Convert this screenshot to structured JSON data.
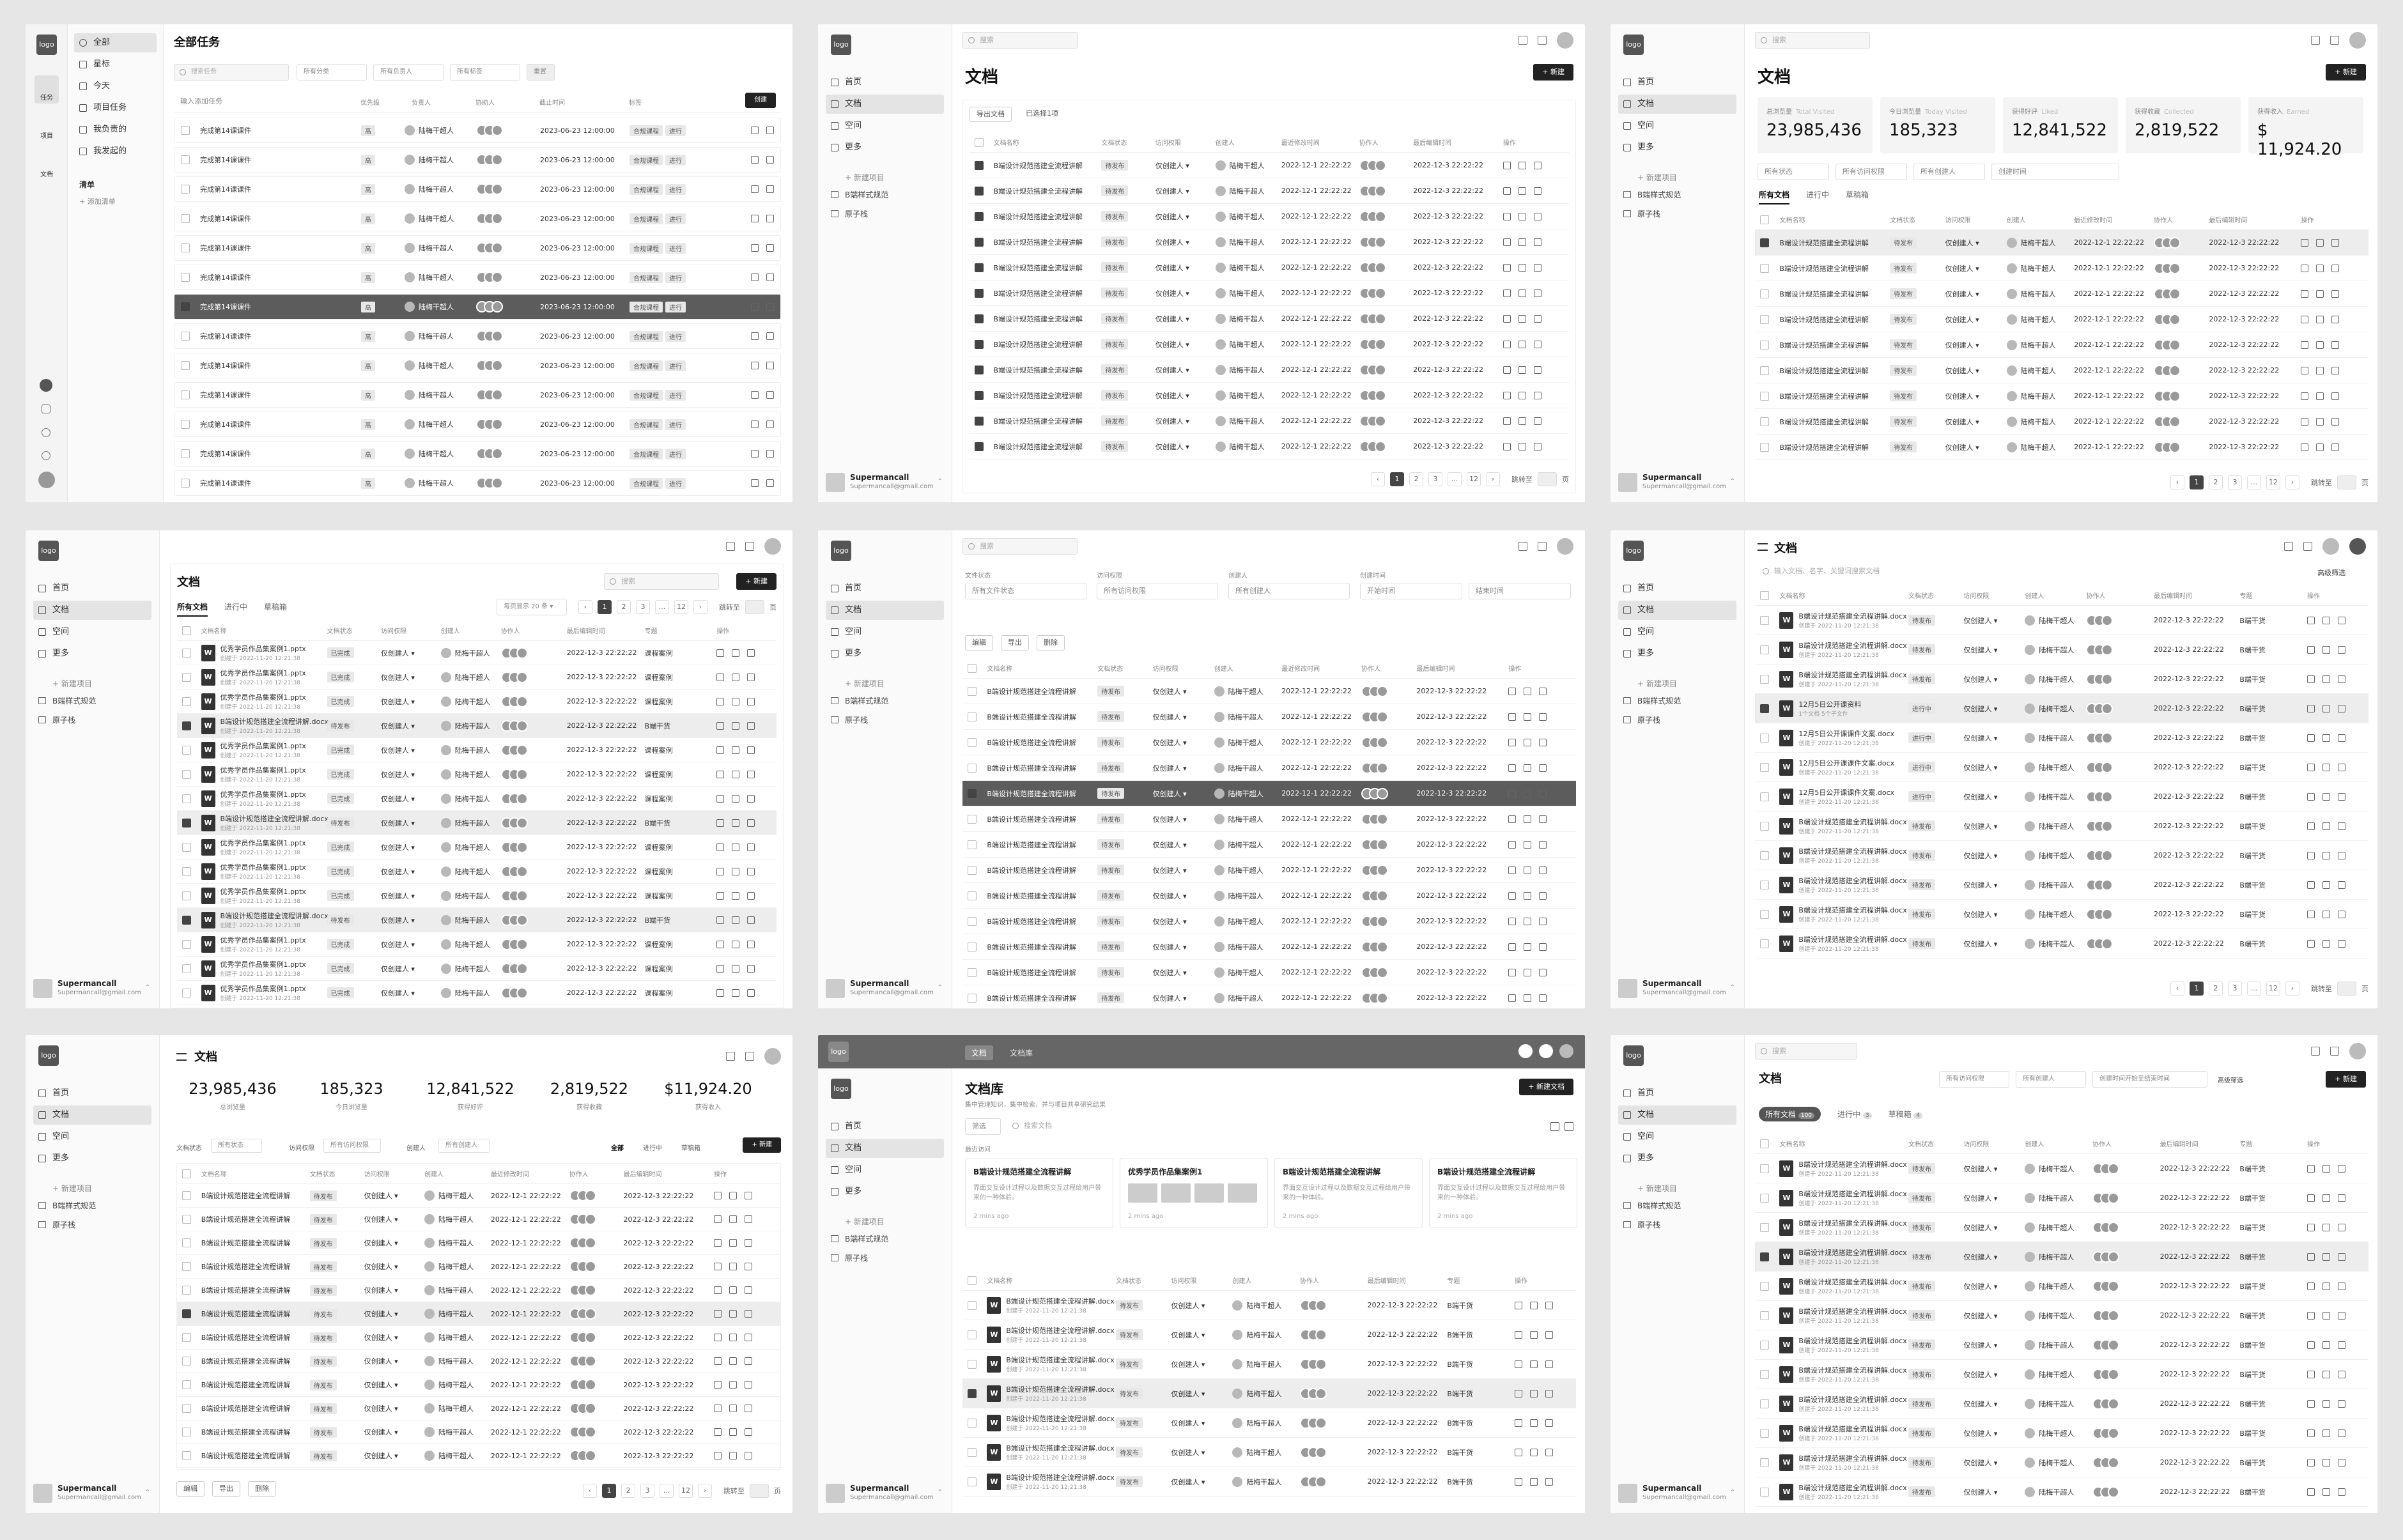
{
  "common": {
    "logo": "logo",
    "nav": [
      "首页",
      "文档",
      "空间",
      "更多"
    ],
    "new_project": "+ 新建项目",
    "projects": [
      "B端样式规范",
      "原子栈"
    ],
    "user_name": "Supermancall",
    "user_email": "Supermancall@gmail.com",
    "search_placeholder": "搜索",
    "doc_title": "文档",
    "new_btn": "+ 新建",
    "edit": "编辑"
  },
  "p1": {
    "title": "全部任务",
    "left_rail": [
      "任务",
      "项目",
      "文档"
    ],
    "menu": [
      "全部",
      "星标",
      "今天",
      "项目任务",
      "我负责的",
      "我发起的"
    ],
    "list_title": "清单",
    "add_list": "+ 添加清单",
    "search": "搜索任务",
    "filters": [
      "所有分类",
      "所有负责人",
      "所有标签"
    ],
    "reset": "重置",
    "input_placeholder": "输入添加任务",
    "cols": [
      "优先级",
      "负责人",
      "协助人",
      "截止时间",
      "标签"
    ],
    "add_btn": "创建",
    "row": {
      "title": "完成第14课课件",
      "priority": "高",
      "owner": "陆梅干超人",
      "due": "2023-06-23 12:00:00",
      "tag1": "合规课程",
      "tag2": "进行"
    }
  },
  "doctable": {
    "cols": [
      "文档名称",
      "文档状态",
      "访问权限",
      "创建人",
      "最近修改时间",
      "协作人",
      "最后编辑时间",
      "操作"
    ],
    "name": "B端设计规范搭建全流程讲解",
    "status": "待发布",
    "access": "仅创建人 ▾",
    "creator": "陆梅干超人",
    "t1": "2022-12-1 22:22:22",
    "t2": "2022-12-3 22:22:22"
  },
  "p2": {
    "tabs": [
      "导出文档",
      "已选择1项"
    ],
    "pager": [
      "‹",
      "1",
      "2",
      "3",
      "...",
      "12",
      "›"
    ],
    "jump": "跳转至",
    "page_unit": "页"
  },
  "p3": {
    "stats": [
      {
        "label": "总浏览量",
        "sub": "Total Visited",
        "value": "23,985,436"
      },
      {
        "label": "今日浏览量",
        "sub": "Today Visited",
        "value": "185,323"
      },
      {
        "label": "获得好评",
        "sub": "Liked",
        "value": "12,841,522"
      },
      {
        "label": "获得收藏",
        "sub": "Collected",
        "value": "2,819,522"
      },
      {
        "label": "获得收入",
        "sub": "Earned",
        "value": "$ 11,924.20"
      }
    ],
    "filters": [
      "所有状态",
      "所有访问权限",
      "所有创建人",
      "创建时间"
    ],
    "date_placeholder": "结束时间",
    "tabs": [
      "所有文档",
      "进行中",
      "草稿箱"
    ]
  },
  "p4": {
    "tabs": [
      "所有文档",
      "进行中",
      "草稿箱"
    ],
    "per_page": "每页显示 20 条 ▾",
    "file1": "优秀学员作品集案例1.pptx",
    "file2": "B端设计规范搭建全流程讲解.docx",
    "file_meta": "创建于 2022-11-20 12:21:38",
    "status_done": "已完成",
    "col_special": "专题",
    "special": "课程案例",
    "special2": "B端干货"
  },
  "p5": {
    "filter_labels": [
      "文件状态",
      "访问权限",
      "创建人",
      "创建时间"
    ],
    "filter_values": [
      "所有文件状态",
      "所有访问权限",
      "所有创建人"
    ],
    "date_start": "开始时间",
    "date_end": "结束时间",
    "actions": [
      "编辑",
      "导出",
      "删除"
    ]
  },
  "p6": {
    "search": "输入文档、名字、关键词搜索文档",
    "adv": "高级筛选",
    "folder": "12月5日公开课资料",
    "folder_meta": "1个文档 5个子文件",
    "file_lesson": "12月5日公开课课件文案.docx",
    "status_ing": "进行中",
    "col_special": "专题"
  },
  "p7": {
    "stats": [
      {
        "value": "23,985,436",
        "label": "总浏览量"
      },
      {
        "value": "185,323",
        "label": "今日浏览量"
      },
      {
        "value": "12,841,522",
        "label": "获得好评"
      },
      {
        "value": "2,819,522",
        "label": "获得收藏"
      },
      {
        "value": "$11,924.20",
        "label": "获得收入"
      }
    ],
    "filters": [
      "文档状态",
      "所有状态",
      "访问权限",
      "所有访问权限",
      "创建人",
      "所有创建人"
    ],
    "seg": [
      "全部",
      "进行中",
      "草稿箱"
    ],
    "actions": [
      "编辑",
      "导出",
      "删除"
    ]
  },
  "p8": {
    "top_tabs": [
      "文档",
      "文档库"
    ],
    "title": "文档库",
    "sub": "集中管理知识，集中检索，并与项目共享研究结果",
    "new_doc": "+ 新建文档",
    "filter_btn": "筛选",
    "search": "搜索文档",
    "recent": "最近访问",
    "cards": [
      {
        "title": "B端设计规范搭建全流程讲解",
        "desc": "界面交互设计过程以及数据交互过程给用户带来的一种体验。",
        "meta": "2 mins ago"
      },
      {
        "title": "优秀学员作品集案例1",
        "desc": "",
        "meta": "2 mins ago"
      },
      {
        "title": "B端设计规范搭建全流程讲解",
        "desc": "界面交互设计过程以及数据交互过程给用户带来的一种体验。",
        "meta": "2 mins ago"
      },
      {
        "title": "B端设计规范搭建全流程讲解",
        "desc": "界面交互设计过程以及数据交互过程给用户带来的一种体验。",
        "meta": "2 mins ago"
      }
    ]
  },
  "p9": {
    "filters": [
      "所有访问权限",
      "所有创建人"
    ],
    "date": "创建时间开始至结束时间",
    "adv": "高级筛选",
    "tabs": [
      "所有文档",
      "进行中",
      "草稿箱"
    ],
    "counts": [
      "100",
      "3",
      "4"
    ],
    "file": "B端设计规范搭建全流程讲解.docx"
  }
}
